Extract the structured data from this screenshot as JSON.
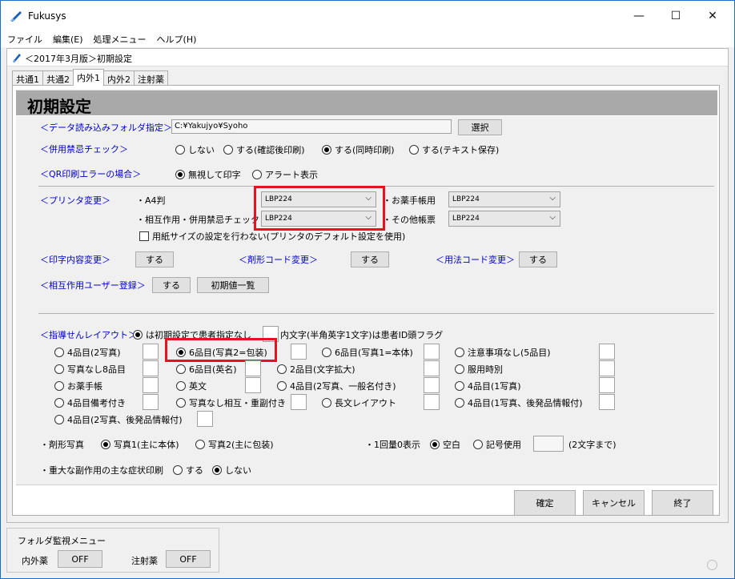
{
  "app": {
    "title": "Fukusys"
  },
  "menu": [
    "ファイル",
    "編集(E)",
    "処理メニュー",
    "ヘルプ(H)"
  ],
  "window_controls": {
    "minimize": "—",
    "maximize": "☐",
    "close": "✕"
  },
  "inner_window": {
    "title": "＜2017年3月版＞初期設定"
  },
  "tabs": [
    {
      "label": "共通1",
      "active": false
    },
    {
      "label": "共通2",
      "active": false
    },
    {
      "label": "内外1",
      "active": true
    },
    {
      "label": "内外2",
      "active": false
    },
    {
      "label": "注射薬",
      "active": false
    }
  ],
  "header": {
    "title": "初期設定"
  },
  "data_folder": {
    "label": "＜データ読み込みフォルダ指定＞",
    "value": "C:¥Yakujyo¥Syoho",
    "button": "選択"
  },
  "contra": {
    "label": "＜併用禁忌チェック＞",
    "options": [
      "しない",
      "する(確認後印刷)",
      "する(同時印刷)",
      "する(テキスト保存)"
    ],
    "selected": 2
  },
  "qr_error": {
    "label": "＜QR印刷エラーの場合＞",
    "options": [
      "無視して印字",
      "アラート表示"
    ],
    "selected": 0
  },
  "printer": {
    "label": "＜プリンタ変更＞",
    "a4_label": "・A4判",
    "a4_value": "LBP224",
    "interaction_label": "・相互作用・併用禁忌チェック",
    "interaction_value": "LBP224",
    "notebook_label": "・お薬手帳用",
    "notebook_value": "LBP224",
    "other_label": "・その他帳票",
    "other_value": "LBP224",
    "paper_size_checkbox": "用紙サイズの設定を行わない(プリンタのデフォルト設定を使用)"
  },
  "print_content": {
    "label": "＜印字内容変更＞",
    "button": "する"
  },
  "drug_code": {
    "label": "＜剤形コード変更＞",
    "button": "する"
  },
  "usage_code": {
    "label": "＜用法コード変更＞",
    "button": "する"
  },
  "interaction_user": {
    "label": "＜相互作用ユーザー登録＞",
    "button": "する",
    "init_button": "初期値一覧"
  },
  "layout": {
    "label": "＜指導せんレイアウト＞(",
    "patient_option": "は初期設定で患者指定なし",
    "flag_text": "内文字(半角英字1文字)は患者ID頭フラグ",
    "col1": [
      "4品目(2写真)",
      "写真なし8品目",
      "お薬手帳",
      "4品目備考付き",
      "4品目(2写真、後発品情報付)"
    ],
    "col2": [
      "6品目(写真2=包装)",
      "6品目(英名)",
      "英文",
      "写真なし相互・重副付き"
    ],
    "col3": [
      "6品目(写真1=本体)",
      "2品目(文字拡大)",
      "4品目(2写真、一般名付き)",
      "長文レイアウト"
    ],
    "col4": [
      "注意事項なし(5品目)",
      "服用時別",
      "4品目(1写真)",
      "4品目(1写真、後発品情報付)"
    ],
    "selected": "6品目(写真2=包装)"
  },
  "drug_photo": {
    "label": "・剤形写真",
    "options": [
      "写真1(主に本体)",
      "写真2(主に包装)"
    ],
    "selected": 0
  },
  "zero_dose": {
    "label": "・1回量0表示",
    "options": [
      "空白",
      "記号使用"
    ],
    "selected": 0,
    "hint": "(2文字まで)"
  },
  "side_effect": {
    "label": "・重大な副作用の主な症状印刷",
    "options": [
      "する",
      "しない"
    ],
    "selected": 1
  },
  "footer_buttons": {
    "ok": "確定",
    "cancel": "キャンセル",
    "exit": "終了"
  },
  "folder_monitor": {
    "title": "フォルダ監視メニュー",
    "internal_label": "内外薬",
    "internal_value": "OFF",
    "injection_label": "注射薬",
    "injection_value": "OFF"
  },
  "colors": {
    "accent": "#0000cc",
    "highlight": "#e8121c",
    "header_bar": "#a9a9a9",
    "border": "#1c6ec4"
  }
}
